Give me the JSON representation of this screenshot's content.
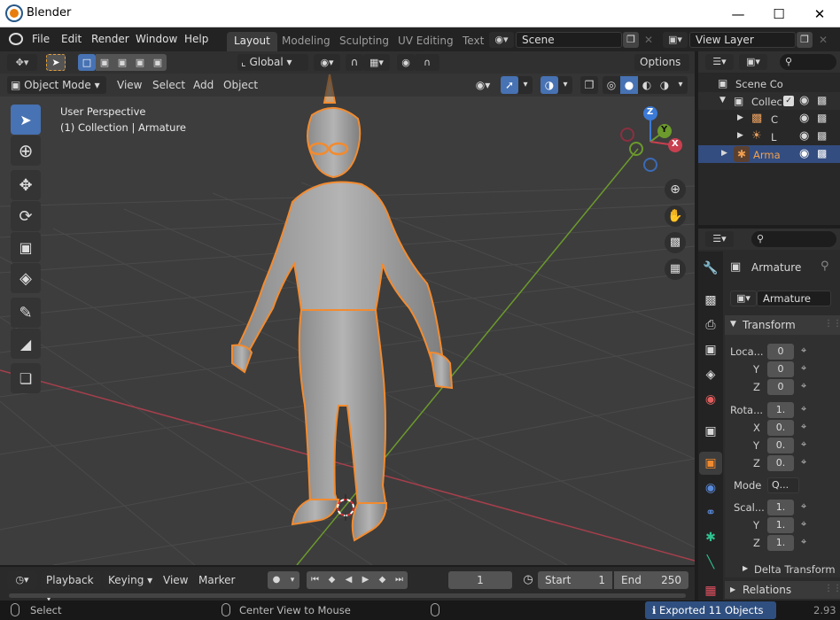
{
  "app": {
    "title": "Blender",
    "version": "2.93"
  },
  "menu": [
    "File",
    "Edit",
    "Render",
    "Window",
    "Help"
  ],
  "workspaces": [
    "Layout",
    "Modeling",
    "Sculpting",
    "UV Editing",
    "Text"
  ],
  "scene": {
    "name": "Scene",
    "view_layer": "View Layer"
  },
  "viewport": {
    "transform_orientation": "Global",
    "options_label": "Options",
    "mode": "Object Mode",
    "menus": [
      "View",
      "Select",
      "Add",
      "Object"
    ],
    "overlay_line1": "User Perspective",
    "overlay_line2": "(1) Collection | Armature",
    "gizmo_axes": {
      "x": "X",
      "y": "Y",
      "z": "Z"
    }
  },
  "outliner": {
    "items": [
      {
        "label": "Scene Co"
      },
      {
        "label": "Collec"
      },
      {
        "label": "C"
      },
      {
        "label": "L"
      },
      {
        "label": "Arma"
      }
    ]
  },
  "properties": {
    "object_name": "Armature",
    "data_name": "Armature",
    "transform_label": "Transform",
    "location": {
      "label": "Loca...",
      "x": "0",
      "y": "0",
      "z": "0"
    },
    "rotation": {
      "label": "Rota...",
      "x": "1.",
      "y": "0.",
      "z": "0.",
      "w": "0."
    },
    "mode": {
      "label": "Mode",
      "value": "Q..."
    },
    "scale": {
      "label": "Scal...",
      "x": "1.",
      "y": "1.",
      "z": "1."
    },
    "axis_y": "Y",
    "axis_z": "Z",
    "axis_x": "X",
    "delta_label": "Delta Transform",
    "relations_label": "Relations"
  },
  "timeline": {
    "playback": "Playback",
    "keying": "Keying",
    "view": "View",
    "marker": "Marker",
    "current_frame": "1",
    "start_label": "Start",
    "start": "1",
    "end_label": "End",
    "end": "250"
  },
  "status": {
    "select": "Select",
    "center_view": "Center View to Mouse",
    "message": "Exported 11 Objects"
  },
  "colors": {
    "accent": "#4772b3",
    "selection": "#f28b30",
    "x_axis": "#a63f4c",
    "y_axis": "#6c9a2c"
  }
}
